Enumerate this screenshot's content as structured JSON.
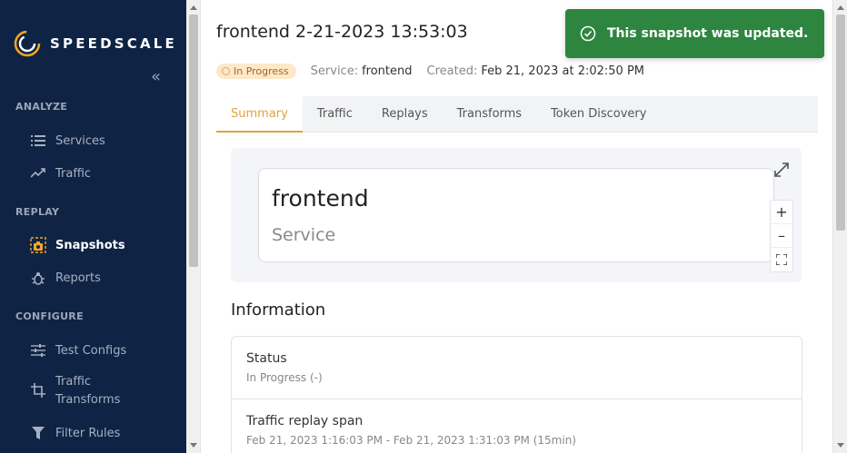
{
  "brand": {
    "name": "SPEEDSCALE"
  },
  "sidebar": {
    "collapse_glyph": "«",
    "sections": {
      "analyze": "ANALYZE",
      "replay": "REPLAY",
      "configure": "CONFIGURE"
    },
    "items": {
      "services": "Services",
      "traffic": "Traffic",
      "snapshots": "Snapshots",
      "reports": "Reports",
      "test_configs": "Test Configs",
      "traffic_transforms_1": "Traffic",
      "traffic_transforms_2": "Transforms",
      "filter_rules": "Filter Rules"
    },
    "active": "Snapshots"
  },
  "header": {
    "title": "frontend 2-21-2023 13:53:03",
    "status_badge": "In Progress",
    "service_label": "Service:",
    "service_value": "frontend",
    "created_label": "Created:",
    "created_value": "Feb 21, 2023 at 2:02:50 PM"
  },
  "tabs": [
    {
      "label": "Summary",
      "active": true
    },
    {
      "label": "Traffic"
    },
    {
      "label": "Replays"
    },
    {
      "label": "Transforms"
    },
    {
      "label": "Token Discovery"
    }
  ],
  "graph": {
    "node_name": "frontend",
    "node_type": "Service",
    "zoom_in": "+",
    "zoom_out": "–"
  },
  "information": {
    "title": "Information",
    "rows": [
      {
        "label": "Status",
        "value": "In Progress (-)"
      },
      {
        "label": "Traffic replay span",
        "value": "Feb 21, 2023 1:16:03 PM - Feb 21, 2023 1:31:03 PM (15min)"
      }
    ]
  },
  "toast": {
    "message": "This snapshot was updated."
  },
  "colors": {
    "sidebar_bg": "#0f2444",
    "accent": "#e0a33a",
    "toast_bg": "#2e8540",
    "badge_bg": "#fde8c8"
  }
}
